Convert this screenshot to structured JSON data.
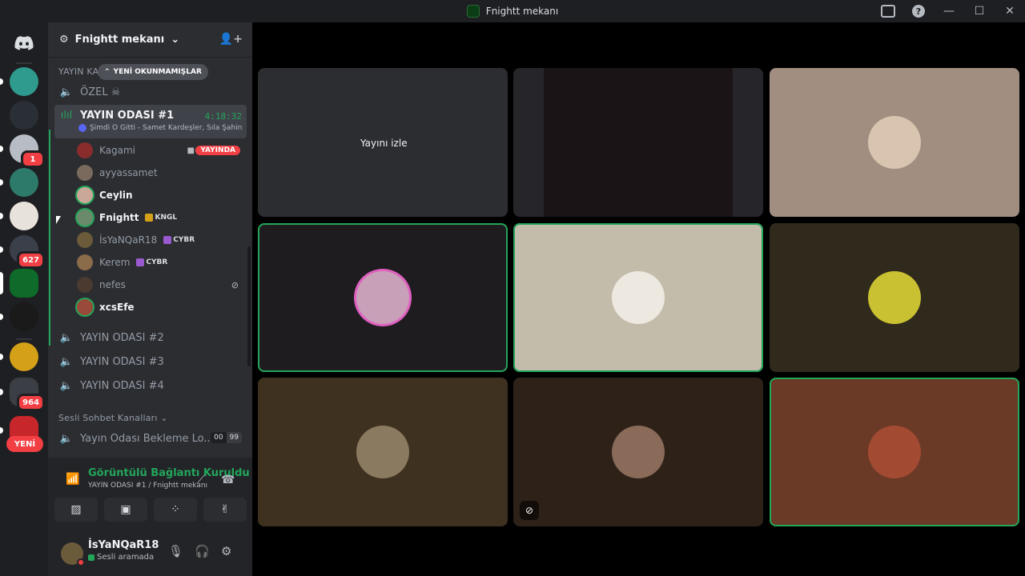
{
  "window": {
    "title": "Fnightt mekanı"
  },
  "server": {
    "name": "Fnightt mekanı"
  },
  "guilds": {
    "unread_badge_1": "1",
    "unread_badge_2": "627",
    "unread_badge_3": "964",
    "new_label": "YENİ"
  },
  "categories": {
    "broadcast_truncated": "YAYIN KA",
    "unread_pill": "YENİ OKUNMAMIŞLAR",
    "voice_chat": "Sesli Sohbet Kanalları"
  },
  "channels": {
    "private": "ÖZEL ☠",
    "active": {
      "name": "YAYIN ODASI #1",
      "timer": "4:18:32",
      "activity": "Şimdi O Gitti - Samet Kardeşler, Sıla Şahin"
    },
    "room2": "YAYIN ODASI #2",
    "room3": "YAYIN ODASI #3",
    "room4": "YAYIN ODASI #4",
    "waiting": "Yayın Odası Bekleme Lo...",
    "waiting_count_a": "00",
    "waiting_count_b": "99"
  },
  "members": [
    {
      "name": "Kagami",
      "live": "YAYINDA"
    },
    {
      "name": "ayyassamet"
    },
    {
      "name": "Ceylin"
    },
    {
      "name": "Fnightt",
      "tag": "KNGL"
    },
    {
      "name": "İsYaNQaR18",
      "tag": "CYBR"
    },
    {
      "name": "Kerem",
      "tag": "CYBR"
    },
    {
      "name": "nefes"
    },
    {
      "name": "xcsEfe"
    }
  ],
  "voice_panel": {
    "status": "Görüntülü Bağlantı Kuruldu",
    "sub": "YAYIN ODASI #1 / Fnightt mekanı"
  },
  "user": {
    "name": "İsYaNQaR18",
    "status": "Sesli aramada"
  },
  "stage": {
    "watch_label": "Yayını izle"
  },
  "colors": {
    "speaking": "#23a55a",
    "live": "#f23f43",
    "sidebar": "#2b2d31",
    "guild_bar": "#1e1f22"
  }
}
